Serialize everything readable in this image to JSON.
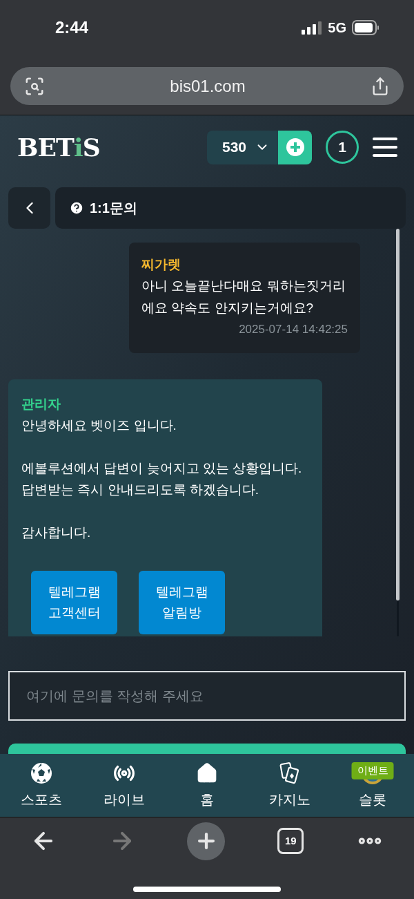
{
  "status_bar": {
    "time": "2:44",
    "network": "5G"
  },
  "browser": {
    "url": "bis01.com",
    "tab_count": "19"
  },
  "header": {
    "logo": [
      {
        "text": "BET"
      },
      {
        "text": "i",
        "color": "#5fbf8a"
      },
      {
        "text": "S"
      }
    ],
    "balance": "530",
    "notifications": "1"
  },
  "page": {
    "title": "1:1문의"
  },
  "messages": [
    {
      "kind": "user",
      "author": "찌가렛",
      "text": "아니 오늘끝난다매요 뭐하는짓거리\n에요 약속도 안지키는거에요?",
      "time": "2025-07-14 14:42:25"
    },
    {
      "kind": "admin",
      "author": "관리자",
      "text": "안녕하세요 벳이즈 입니다.\n\n에볼루션에서 답변이 늦어지고 있는 상황입니다.\n답변받는 즉시 안내드리도록 하겠습니다.\n\n감사합니다.",
      "buttons": [
        "텔레그램\n고객센터",
        "텔레그램\n알림방"
      ]
    }
  ],
  "input": {
    "placeholder": "여기에 문의를 작성해 주세요"
  },
  "bottom_nav": [
    {
      "kind": "sports",
      "label": "스포츠"
    },
    {
      "kind": "live",
      "label": "라이브"
    },
    {
      "kind": "home",
      "label": "홈"
    },
    {
      "kind": "casino",
      "label": "카지노"
    },
    {
      "kind": "slot",
      "label": "슬롯",
      "badge": "이벤트"
    }
  ],
  "toolbar": {
    "forward_disabled": true
  }
}
